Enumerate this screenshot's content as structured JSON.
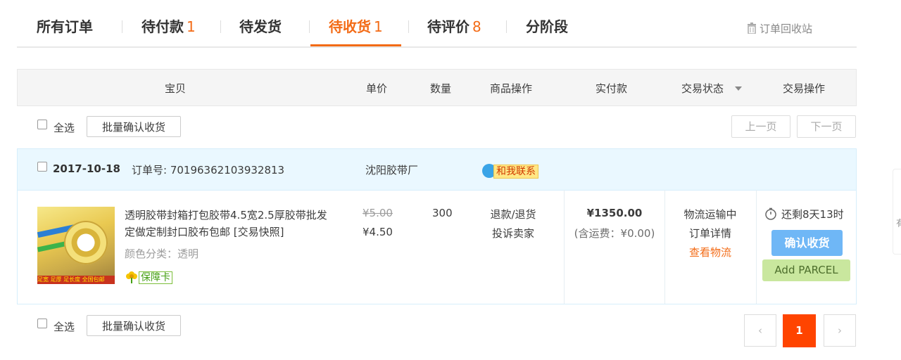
{
  "tabs": [
    {
      "label": "所有订单",
      "count": ""
    },
    {
      "label": "待付款",
      "count": "1"
    },
    {
      "label": "待发货",
      "count": ""
    },
    {
      "label": "待收货",
      "count": "1"
    },
    {
      "label": "待评价",
      "count": "8"
    },
    {
      "label": "分阶段",
      "count": ""
    }
  ],
  "active_tab": "待收货",
  "recycle_bin": "订单回收站",
  "table_header": {
    "item": "宝贝",
    "unit_price": "单价",
    "quantity": "数量",
    "item_ops": "商品操作",
    "paid": "实付款",
    "status": "交易状态",
    "ops": "交易操作"
  },
  "toolbar": {
    "select_all": "全选",
    "batch_confirm": "批量确认收货",
    "prev_page": "上一页",
    "next_page": "下一页"
  },
  "order": {
    "date": "2017-10-18",
    "order_no_label": "订单号:",
    "order_no": "70196362103932813",
    "shop": "沈阳胶带厂",
    "contact": "和我联系",
    "product_title": "透明胶带封箱打包胶带4.5宽2.5厚胶带批发定做定制封口胶布包邮 [交易快照]",
    "color_label": "颜色分类：透明",
    "guarantee_card": "保障卡",
    "thumb_caption": "足宽 足厚 足长度 全国包邮",
    "original_price": "¥5.00",
    "price": "¥4.50",
    "quantity": "300",
    "refund": "退款/退货",
    "complain": "投诉卖家",
    "paid_total": "¥1350.00",
    "shipping": "(含运费：¥0.00)",
    "status": "物流运输中",
    "detail": "订单详情",
    "logistics": "查看物流",
    "remaining": "还剩8天13时",
    "confirm_button": "确认收货",
    "add_parcel_button": "Add PARCEL"
  },
  "pagination": {
    "prev": "‹",
    "current": "1",
    "next": "›"
  },
  "side_float_text": "有",
  "colors": {
    "accent": "#f36b16",
    "confirm_blue": "#6fb7f6",
    "parcel_green": "#c9e79e",
    "page_current": "#ff4400",
    "order_head_bg": "#eaf8ff"
  }
}
